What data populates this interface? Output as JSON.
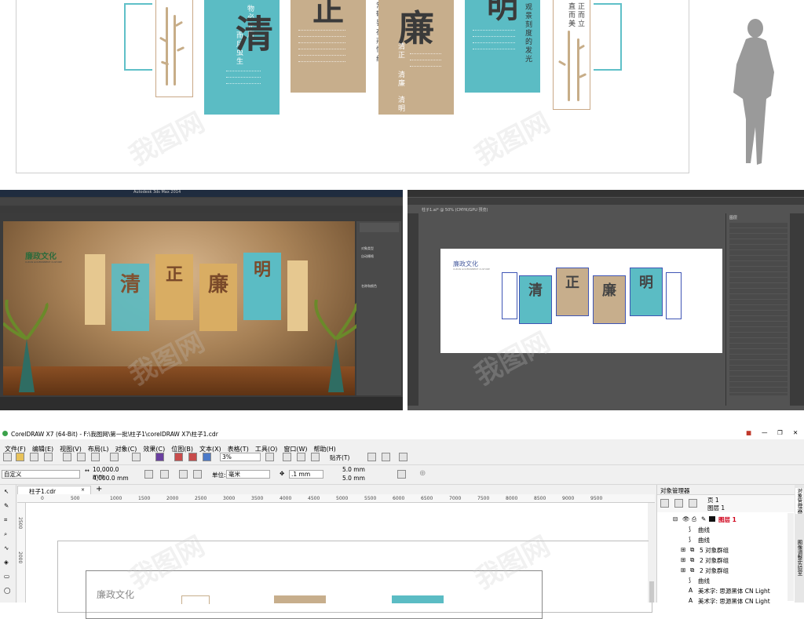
{
  "elevation": {
    "chars": [
      "清",
      "正",
      "廉",
      "明"
    ],
    "left_vertical": [
      "物必先腐",
      "而后虫生"
    ],
    "mid_vertical": [
      "常敬畏",
      "存戒惧",
      "守底线"
    ],
    "lian_vertical": [
      "清正",
      "清廉",
      "清明"
    ],
    "ming_vertical": [
      "观景刻度的发光"
    ],
    "right_vertical": [
      "正而立",
      "直而美"
    ]
  },
  "max3d": {
    "title": "Autodesk 3ds Max 2014",
    "sign": "廉政文化",
    "sign_en": "CLEAN GOVERNMENT CULTURE",
    "chars": [
      "清",
      "正",
      "廉",
      "明"
    ],
    "menu_items": [
      "对象类型",
      "自动栅格",
      "名称和颜色"
    ]
  },
  "illustrator": {
    "title": "柱子1.ai* @ 50% (CMYK/GPU 预览)",
    "sign": "廉政文化",
    "sign_en": "CLEAN GOVERNMENT CULTURE",
    "chars": [
      "清",
      "正",
      "廉",
      "明"
    ],
    "panel_title": "图层"
  },
  "corel": {
    "title": "CorelDRAW X7 (64-Bit) - F:\\我图网\\第一批\\柱子1\\coreIDRAW X7\\柱子1.cdr",
    "menu": [
      "文件(F)",
      "编辑(E)",
      "视图(V)",
      "布局(L)",
      "对象(C)",
      "效果(C)",
      "位图(B)",
      "文本(X)",
      "表格(T)",
      "工具(O)",
      "窗口(W)",
      "帮助(H)"
    ],
    "zoom": "3%",
    "snap_label": "贴齐(T)",
    "page_size_label": "自定义",
    "width": "10,000.0 mm",
    "height": "4,000.0 mm",
    "unit_label": "单位:",
    "unit": "毫米",
    "nudge": ".1 mm",
    "dup_x": "5.0 mm",
    "dup_y": "5.0 mm",
    "doc_tab": "柱子1.cdr",
    "ruler_ticks": [
      "0",
      "500",
      "1000",
      "1500",
      "2000",
      "2500",
      "3000",
      "3500",
      "4000",
      "4500",
      "5000",
      "5500",
      "6000",
      "6500",
      "7000",
      "7500",
      "8000",
      "8500",
      "9000",
      "9500"
    ],
    "vruler_ticks": [
      "2500",
      "2000"
    ],
    "canvas_sign": "廉政文化",
    "om_title": "对象管理器",
    "om_page": "页 1",
    "om_layer": "图层 1",
    "om_layer_active": "图层 1",
    "om_items": [
      "曲线",
      "曲线",
      "5 对象群组",
      "2 对象群组",
      "2 对象群组",
      "曲线",
      "美术字: 思源黑体 CN Light",
      "美术字: 思源黑体 CN Light"
    ],
    "side_tabs": [
      "对象管理器",
      "图像调整实验室"
    ]
  },
  "watermark": "我图网",
  "colors": {
    "teal": "#5bbcc4",
    "tan": "#c7ae8c",
    "active_layer": "#d0021b"
  }
}
